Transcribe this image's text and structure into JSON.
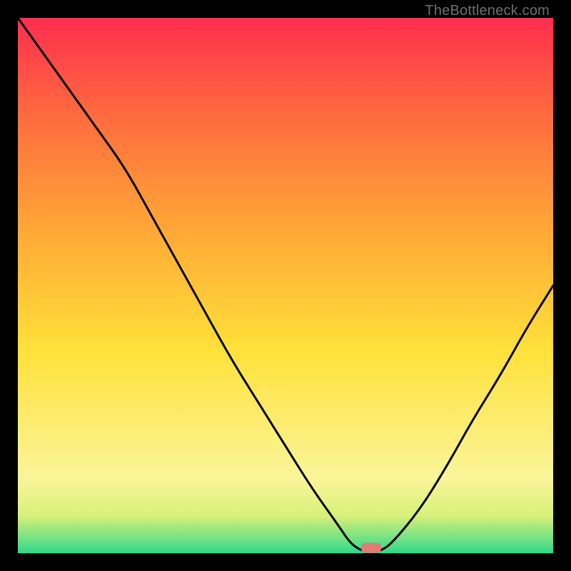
{
  "watermark": "TheBottleneck.com",
  "colors": {
    "gradient_top": "#ff2e4e",
    "gradient_mid_red_orange": "#ff6a3f",
    "gradient_orange": "#ffa936",
    "gradient_yellow": "#ffe13a",
    "gradient_pale_yellow": "#faf59a",
    "gradient_yellow_green": "#d8f07a",
    "gradient_green": "#2fd98c",
    "curve": "#000000",
    "marker": "#e47a74",
    "frame": "#000000"
  },
  "chart_data": {
    "type": "line",
    "title": "",
    "xlabel": "",
    "ylabel": "",
    "xlim": [
      0,
      100
    ],
    "ylim": [
      0,
      100
    ],
    "x": [
      0,
      5,
      10,
      15,
      20,
      25,
      30,
      35,
      40,
      45,
      50,
      55,
      60,
      62,
      64,
      66,
      68,
      70,
      75,
      80,
      85,
      90,
      95,
      100
    ],
    "y": [
      100,
      93,
      86,
      79,
      72,
      63,
      54,
      45,
      36,
      28,
      20,
      12,
      5,
      2,
      0.5,
      0.3,
      0.5,
      2,
      8,
      16,
      25,
      33,
      42,
      50
    ],
    "marker_x": 66,
    "marker_y": 0.3,
    "annotations": [
      "TheBottleneck.com"
    ]
  }
}
